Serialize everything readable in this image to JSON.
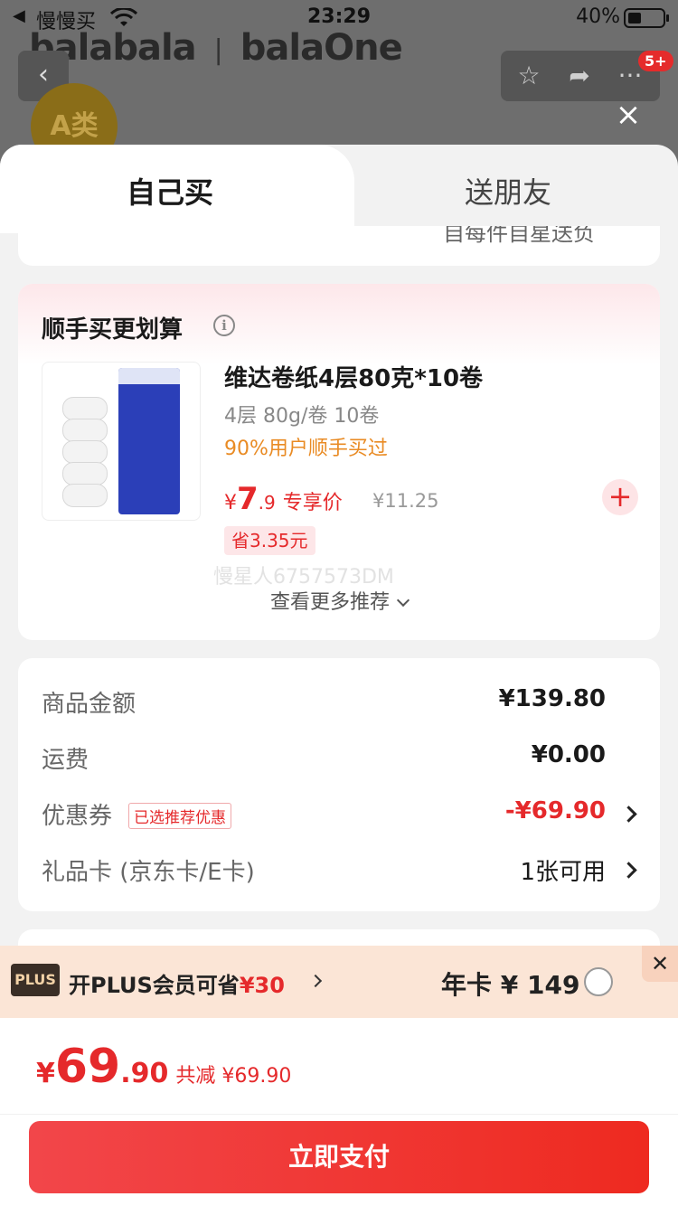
{
  "status_bar": {
    "back_label": "◀",
    "carrier": "慢慢买",
    "time": "23:29",
    "battery": "40%"
  },
  "background": {
    "brand": "balabala",
    "brand2": "balaOne",
    "cart_badge": "5+",
    "category_badge": "A类"
  },
  "tabs": [
    {
      "label": "自己买"
    },
    {
      "label": "送朋友"
    }
  ],
  "top_card_text": "自每件自星送负",
  "recommend": {
    "title": "顺手买更划算",
    "info_icon": "i",
    "product": {
      "name": "维达卷纸4层80克*10卷",
      "spec": "4层 80g/卷 10卷",
      "buyers": "90%用户顺手买过",
      "price_currency": "¥",
      "price_int": "7",
      "price_dec": ".9",
      "price_tag": "专享价",
      "original_price": "¥11.25",
      "save": "省3.35元",
      "add_icon": "+"
    },
    "watermark": "慢星人6757573DM",
    "more": "查看更多推荐"
  },
  "summary": {
    "rows": [
      {
        "label": "商品金额",
        "value": "¥139.80"
      },
      {
        "label": "运费",
        "value": "¥0.00"
      },
      {
        "label": "优惠券",
        "tag": "已选推荐优惠",
        "value": "-¥69.90"
      },
      {
        "label": "礼品卡 (京东卡/E卡)",
        "value": "1张可用"
      }
    ]
  },
  "plus": {
    "logo": "PLUS",
    "text": "开PLUS会员可省",
    "amount": "¥30",
    "annual": "年卡 ¥ 149",
    "close": "✕"
  },
  "bottom": {
    "currency": "¥",
    "total_int": "69",
    "total_dec": ".90",
    "reduce": "共减 ¥69.90",
    "pay_label": "立即支付"
  },
  "colors": {
    "accent": "#e5292b",
    "orange": "#e98b24",
    "plus_bg": "#fbe5d6"
  }
}
